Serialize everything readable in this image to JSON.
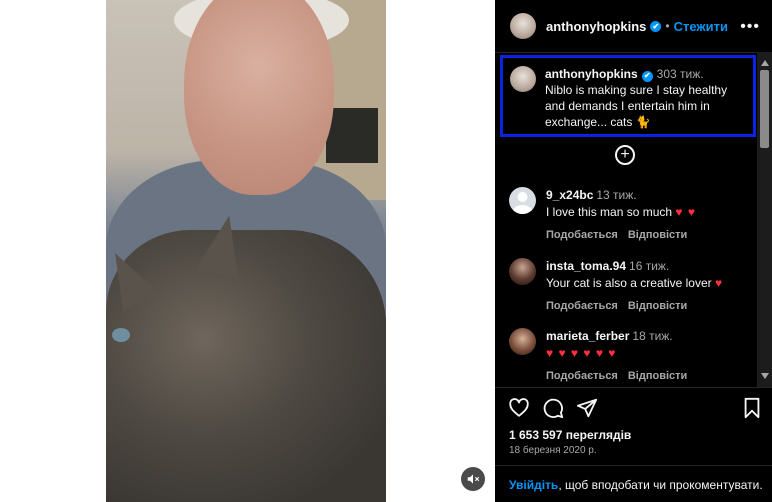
{
  "post": {
    "author": "anthonyhopkins",
    "verified_mark": "✔",
    "follow_label": "Стежити",
    "more_label": "•••",
    "mute_icon": "speaker-muted-icon"
  },
  "caption": {
    "username": "anthonyhopkins",
    "time": "303 тиж.",
    "text": "Niblo is making sure I stay healthy and demands I entertain him in exchange... cats 🐈"
  },
  "load_more_label": "+",
  "comments": [
    {
      "username": "9_x24bc",
      "time": "13 тиж.",
      "text": "I love this man so much",
      "hearts": "♥ ♥",
      "like_label": "Подобається",
      "reply_label": "Відповісти"
    },
    {
      "username": "insta_toma.94",
      "time": "16 тиж.",
      "text": "Your cat is also a creative lover",
      "hearts": "♥",
      "like_label": "Подобається",
      "reply_label": "Відповісти"
    },
    {
      "username": "marieta_ferber",
      "time": "18 тиж.",
      "text": "",
      "hearts": "♥ ♥ ♥ ♥ ♥ ♥",
      "like_label": "Подобається",
      "reply_label": "Відповісти"
    }
  ],
  "stats": {
    "views": "1 653 597 переглядів",
    "date": "18 березня 2020 р."
  },
  "login_prompt": {
    "link": "Увійдіть",
    "rest": ", щоб вподобати чи прокоментувати."
  },
  "colors": {
    "accent": "#0095f6",
    "highlight_border": "#0a24e6",
    "heart": "#ff3040",
    "panel_bg": "#000000"
  }
}
